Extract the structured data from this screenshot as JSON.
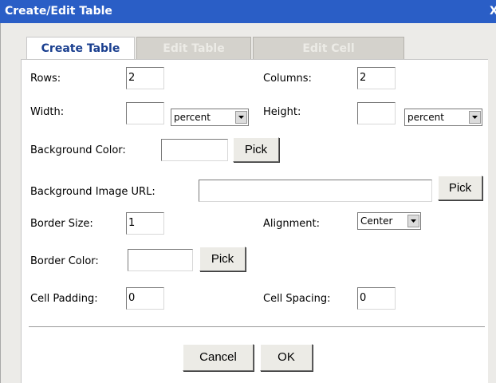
{
  "window": {
    "title": "Create/Edit Table",
    "close_glyph": "X"
  },
  "tabs": [
    {
      "label": "Create Table",
      "active": true
    },
    {
      "label": "Edit Table",
      "active": false
    },
    {
      "label": "Edit Cell",
      "active": false
    }
  ],
  "form": {
    "rows": {
      "label": "Rows:",
      "value": "2"
    },
    "columns": {
      "label": "Columns:",
      "value": "2"
    },
    "width": {
      "label": "Width:",
      "value": "",
      "unit": "percent"
    },
    "height": {
      "label": "Height:",
      "value": "",
      "unit": "percent"
    },
    "background_color": {
      "label": "Background Color:",
      "value": "",
      "pick_label": "Pick"
    },
    "background_image_url": {
      "label": "Background Image URL:",
      "value": "",
      "pick_label": "Pick"
    },
    "border_size": {
      "label": "Border Size:",
      "value": "1"
    },
    "alignment": {
      "label": "Alignment:",
      "value": "Center"
    },
    "border_color": {
      "label": "Border Color:",
      "value": "",
      "pick_label": "Pick"
    },
    "cell_padding": {
      "label": "Cell Padding:",
      "value": "0"
    },
    "cell_spacing": {
      "label": "Cell Spacing:",
      "value": "0"
    }
  },
  "buttons": {
    "cancel": "Cancel",
    "ok": "OK"
  },
  "colors": {
    "titlebar": "#2a5ec6",
    "dialog_bg": "#ecebe8",
    "active_tab_text": "#1a3f8f"
  }
}
